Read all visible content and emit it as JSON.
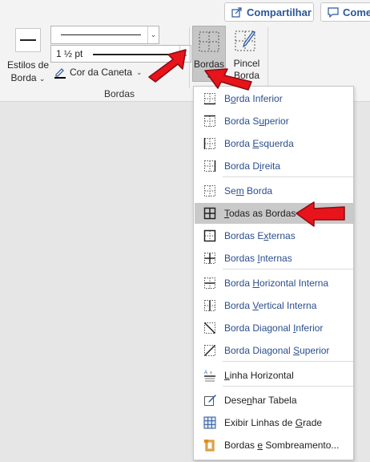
{
  "top_buttons": {
    "share_label": "Compartilhar",
    "comment_label": "Comer"
  },
  "ribbon": {
    "estilos_label_line1": "Estilos de",
    "estilos_label_line2": "Borda",
    "weight_value": "1 ½ pt",
    "pen_color_label": "Cor da Caneta",
    "bordas_label": "Bordas",
    "pincel_label_line1": "Pincel",
    "pincel_label_line2": "Borda",
    "group_label": "Bordas",
    "accent_color": "#2b579a"
  },
  "menu": {
    "items": [
      {
        "pre": "B",
        "acc": "o",
        "post": "rda Inferior",
        "icon": "border-bottom-icon"
      },
      {
        "pre": "Borda S",
        "acc": "u",
        "post": "perior",
        "icon": "border-top-icon"
      },
      {
        "pre": "Borda ",
        "acc": "E",
        "post": "squerda",
        "icon": "border-left-icon"
      },
      {
        "pre": "Borda D",
        "acc": "i",
        "post": "reita",
        "icon": "border-right-icon"
      },
      {
        "pre": "Se",
        "acc": "m",
        "post": " Borda",
        "icon": "no-border-icon"
      },
      {
        "pre": "",
        "acc": "T",
        "post": "odas as Bordas",
        "icon": "all-borders-icon",
        "selected": true
      },
      {
        "pre": "Bordas E",
        "acc": "x",
        "post": "ternas",
        "icon": "outside-borders-icon"
      },
      {
        "pre": "Bordas ",
        "acc": "I",
        "post": "nternas",
        "icon": "inside-borders-icon"
      },
      {
        "pre": "Borda ",
        "acc": "H",
        "post": "orizontal Interna",
        "icon": "inside-horizontal-icon"
      },
      {
        "pre": "Borda ",
        "acc": "V",
        "post": "ertical Interna",
        "icon": "inside-vertical-icon"
      },
      {
        "pre": "Borda Diagonal ",
        "acc": "I",
        "post": "nferior",
        "icon": "diagonal-down-icon"
      },
      {
        "pre": "Borda Diagonal ",
        "acc": "S",
        "post": "uperior",
        "icon": "diagonal-up-icon"
      },
      {
        "pre": "",
        "acc": "L",
        "post": "inha Horizontal",
        "icon": "horizontal-line-icon"
      },
      {
        "pre": "Dese",
        "acc": "n",
        "post": "har Tabela",
        "icon": "draw-table-icon"
      },
      {
        "pre": "Exibir Linhas de ",
        "acc": "G",
        "post": "rade",
        "icon": "gridlines-icon"
      },
      {
        "pre": "Bordas ",
        "acc": "e",
        "post": " Sombreamento...",
        "icon": "borders-shading-icon"
      }
    ]
  },
  "colors": {
    "menu_text": "#2b4e8c",
    "selected_bg": "#c9c9c9",
    "arrow": "#e8141b"
  }
}
